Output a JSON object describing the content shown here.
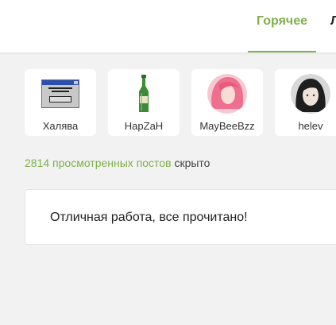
{
  "header": {
    "tabs": [
      {
        "label": "Горячее",
        "active": true
      },
      {
        "label": "Л",
        "active": false
      }
    ],
    "accent_color": "#7fb04a"
  },
  "authors": [
    {
      "name": "Халява",
      "avatar": "win98-window-icon"
    },
    {
      "name": "HapZaH",
      "avatar": "green-bottle-icon"
    },
    {
      "name": "MayBeeBzz",
      "avatar": "pink-hair-avatar"
    },
    {
      "name": "helev",
      "avatar": "dark-hair-avatar"
    }
  ],
  "feed": {
    "viewed_link": "2814 просмотренных постов",
    "viewed_suffix": "скрыто",
    "done_message": "Отличная работа, все прочитано!"
  }
}
